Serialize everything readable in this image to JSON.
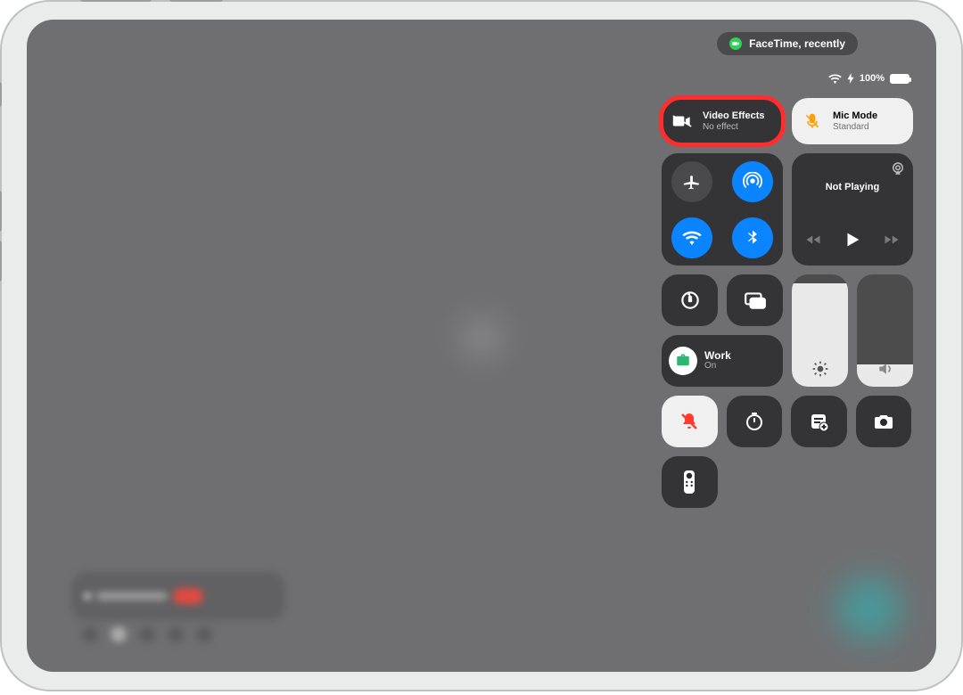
{
  "status_pill": {
    "app": "FaceTime",
    "suffix": ", recently"
  },
  "status_right": {
    "battery_percent": "100%"
  },
  "tiles": {
    "video_effects": {
      "title": "Video Effects",
      "subtitle": "No effect"
    },
    "mic_mode": {
      "title": "Mic Mode",
      "subtitle": "Standard"
    },
    "media": {
      "now_playing": "Not Playing"
    },
    "focus": {
      "title": "Work",
      "subtitle": "On"
    }
  },
  "sliders": {
    "brightness_fill_pct": 92,
    "volume_fill_pct": 20
  },
  "icons": {
    "facetime": "facetime-camera",
    "video_off": "video-camera-slash",
    "mic_mute": "mic-slash",
    "airplane": "airplane",
    "airdrop": "airdrop",
    "wifi": "wifi",
    "bluetooth": "bluetooth",
    "airplay": "airplay",
    "prev": "backward",
    "play": "play",
    "next": "forward",
    "orientation_lock": "rotation-lock",
    "screen_mirroring": "screen-mirroring",
    "focus": "briefcase",
    "brightness": "sun",
    "volume": "speaker",
    "silent": "bell-slash",
    "timer": "timer",
    "quick_note": "note-add",
    "camera": "camera",
    "remote": "apple-tv-remote",
    "charging": "bolt",
    "battery": "battery"
  }
}
